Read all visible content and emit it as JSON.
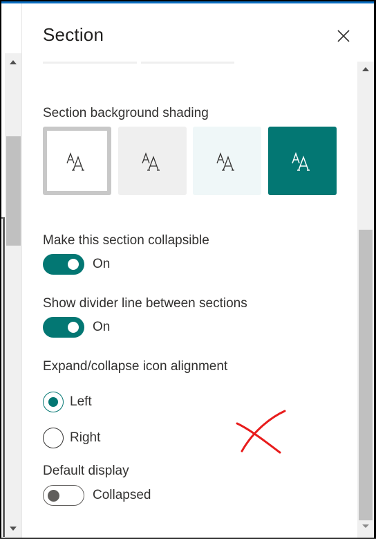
{
  "panel": {
    "title": "Section",
    "close_icon": "close-icon",
    "accent_color": "#037773",
    "topbar_color": "#0a6fc2"
  },
  "shading": {
    "label": "Section background shading",
    "options": [
      {
        "name": "none",
        "background": "#ffffff",
        "glyph": "AA",
        "selected": true
      },
      {
        "name": "neutral",
        "background": "#efefef",
        "glyph": "AA",
        "selected": false
      },
      {
        "name": "soft",
        "background": "#eff7f8",
        "glyph": "AA",
        "selected": false
      },
      {
        "name": "strong",
        "background": "#037773",
        "glyph": "AA",
        "selected": false
      }
    ]
  },
  "collapsible": {
    "label": "Make this section collapsible",
    "state_text": "On",
    "on": true
  },
  "divider": {
    "label": "Show divider line between sections",
    "state_text": "On",
    "on": true
  },
  "alignment": {
    "label": "Expand/collapse icon alignment",
    "options": [
      {
        "label": "Left",
        "checked": true
      },
      {
        "label": "Right",
        "checked": false
      }
    ]
  },
  "default_display": {
    "label": "Default display",
    "state_text": "Collapsed",
    "on": false
  },
  "annotation": {
    "mark": "red-x",
    "color": "#e81c1c"
  }
}
